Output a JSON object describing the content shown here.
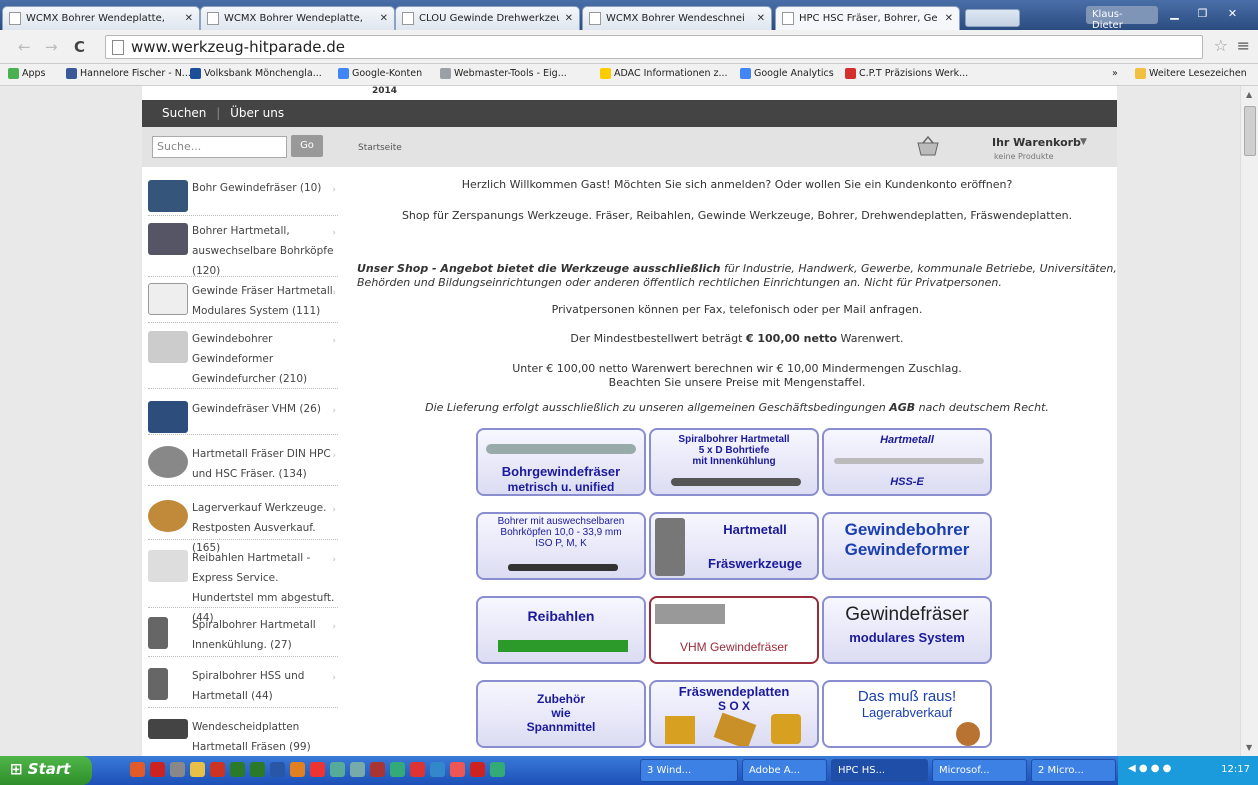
{
  "browser": {
    "tabs": [
      {
        "label": "WCMX Bohrer Wendeplatte,"
      },
      {
        "label": "WCMX Bohrer Wendeplatte,"
      },
      {
        "label": "CLOU Gewinde Drehwerkzeu"
      },
      {
        "label": "WCMX Bohrer Wendeschnei"
      },
      {
        "label": "HPC HSC Fräser, Bohrer, Ge"
      }
    ],
    "user": "Klaus-Dieter",
    "url": "www.werkzeug-hitparade.de",
    "bookmarks": [
      {
        "label": "Apps",
        "color": "#4caf50"
      },
      {
        "label": "Hannelore Fischer - N...",
        "color": "#3b5998"
      },
      {
        "label": "Volksbank Mönchengla...",
        "color": "#1c4e9a"
      },
      {
        "label": "Google-Konten",
        "color": "#4285f4"
      },
      {
        "label": "Webmaster-Tools - Eig...",
        "color": "#9aa0a6"
      },
      {
        "label": "ADAC Informationen z...",
        "color": "#ffcc00"
      },
      {
        "label": "Google Analytics",
        "color": "#4285f4"
      },
      {
        "label": "C.P.T Präzisions Werk...",
        "color": "#d32f2f"
      }
    ],
    "more_bookmarks": "»",
    "other_bookmarks": "Weitere Lesezeichen"
  },
  "site": {
    "year": "2014",
    "nav": [
      "Suchen",
      "Über uns"
    ],
    "search_placeholder": "Suche...",
    "go_label": "Go",
    "breadcrumb": "Startseite",
    "cart_title": "Ihr Warenkorb",
    "cart_sub": "keine Produkte",
    "categories": [
      {
        "label": "Bohr Gewindefräser (10)"
      },
      {
        "label": "Bohrer Hartmetall, auswechselbare Bohrköpfe (120)"
      },
      {
        "label": "Gewinde Fräser Hartmetall Modulares System (111)"
      },
      {
        "label": "Gewindebohrer Gewindeformer Gewindefurcher (210)"
      },
      {
        "label": "Gewindefräser VHM (26)"
      },
      {
        "label": "Hartmetall Fräser DIN HPC und HSC Fräser. (134)"
      },
      {
        "label": "Lagerverkauf Werkzeuge. Restposten Ausverkauf. (165)"
      },
      {
        "label": "Reibahlen Hartmetall - Express Service. Hundertstel mm abgestuft. (44)"
      },
      {
        "label": "Spiralbohrer Hartmetall Innenkühlung. (27)"
      },
      {
        "label": "Spiralbohrer HSS und Hartmetall (44)"
      },
      {
        "label": "Wendescheidplatten Hartmetall Fräsen (99)"
      }
    ],
    "welcome": "Herzlich Willkommen Gast! Möchten Sie sich anmelden? Oder wollen Sie ein Kundenkonto eröffnen?",
    "shop_line": "Shop für Zerspanungs  Werkzeuge. Fräser, Reibahlen, Gewinde Werkzeuge, Bohrer, Drehwendeplatten, Fräswendeplatten.",
    "offer_bold": "Unser Shop - Angebot bietet die Werkzeuge ausschließlich",
    "offer_rest": " für Industrie, Handwerk, Gewerbe, kommunale Betriebe, Universitäten, Behörden und Bildungseinrichtungen oder anderen öffentlich rechtlichen Einrichtungen an. Nicht für Privatpersonen.",
    "private": "Privatpersonen können per Fax, telefonisch oder per Mail anfragen.",
    "min_order_pre": "Der Mindestbestellwert beträgt ",
    "min_order_bold": "€ 100,00 netto",
    "min_order_post": " Warenwert.",
    "surcharge1": "Unter € 100,00 netto Warenwert berechnen wir € 10,00 Mindermengen Zuschlag.",
    "surcharge2": "Beachten Sie unsere Preise mit Mengenstaffel.",
    "delivery_pre": "Die Lieferung erfolgt ausschließlich zu unseren allgemeinen Geschäftsbedingungen ",
    "delivery_bold": "AGB",
    "delivery_post": " nach deutschem Recht.",
    "tiles": [
      {
        "l1": "Bohrgewindefräser",
        "l2": "metrisch u. unified"
      },
      {
        "l1": "Spiralbohrer Hartmetall",
        "l2": "5 x D Bohrtiefe",
        "l3": "mit Innenkühlung"
      },
      {
        "l1": "Hartmetall",
        "l2": "HSS-E"
      },
      {
        "l1": "Bohrer mit auswechselbaren",
        "l2": "Bohrköpfen 10,0 - 33,9 mm",
        "l3": "ISO P, M, K"
      },
      {
        "l1": "Hartmetall",
        "l2": "Fräswerkzeuge"
      },
      {
        "l1": "Gewindebohrer",
        "l2": "Gewindeformer"
      },
      {
        "l1": "Reibahlen"
      },
      {
        "l1": "VHM Gewindefräser"
      },
      {
        "l1": "Gewindefräser",
        "l2": "modulares System"
      },
      {
        "l1": "Zubehör",
        "l2": "wie",
        "l3": "Spannmittel"
      },
      {
        "l1": "Fräswendeplatten",
        "l2": "S O X"
      },
      {
        "l1": "Das muß raus!",
        "l2": "Lagerabverkauf"
      }
    ]
  },
  "taskbar": {
    "start": "Start",
    "tasks": [
      "3 Wind...",
      "Adobe A...",
      "HPC HS...",
      "Microsof...",
      "2 Micro..."
    ],
    "clock": "12:17"
  }
}
